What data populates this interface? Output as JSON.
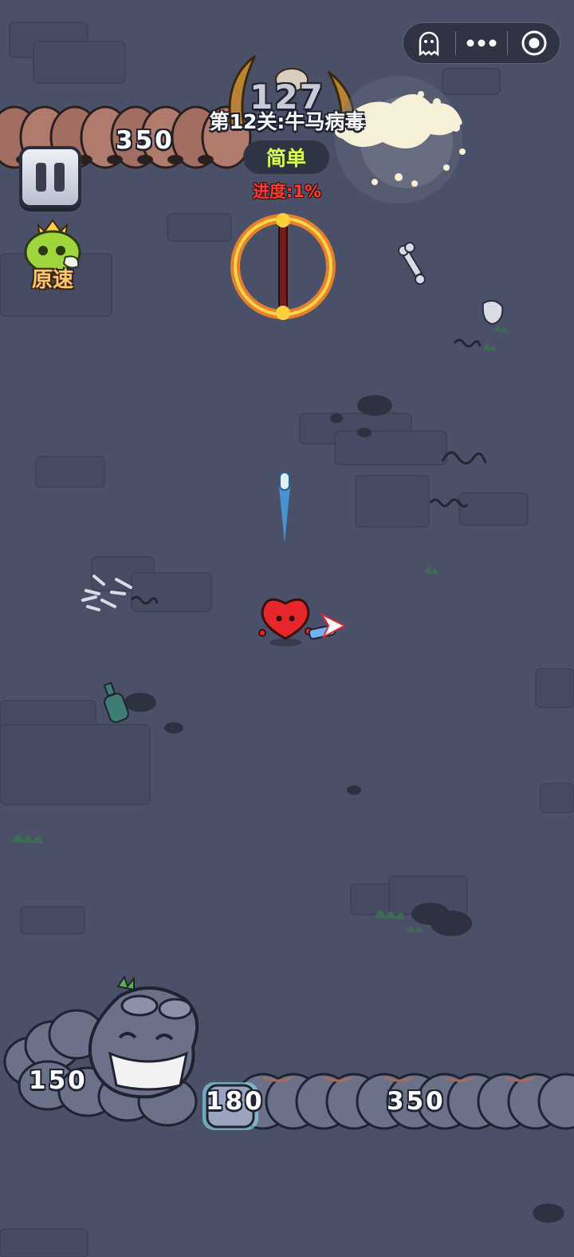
{
  "menu_capsule": {
    "icons": [
      "ghost-icon",
      "more-dots-icon",
      "target-icon"
    ]
  },
  "hud": {
    "pause_icon": "pause-icon",
    "speed_label": "原速",
    "boss_count": "127",
    "level_title": "第12关:牛马病毒",
    "difficulty": "简单",
    "progress": "进度:1%"
  },
  "enemies": {
    "top_worm_hp": "350",
    "bottom_worm_head_hp": "150",
    "bottom_worm_segment_hp": "180",
    "bottom_worm_tail_hp": "350"
  },
  "colors": {
    "background": "#4a5068",
    "difficulty_text": "#d9ff4a",
    "progress_text": "#ff3b30",
    "speed_text": "#ffc766",
    "player_heart": "#e5262b"
  }
}
